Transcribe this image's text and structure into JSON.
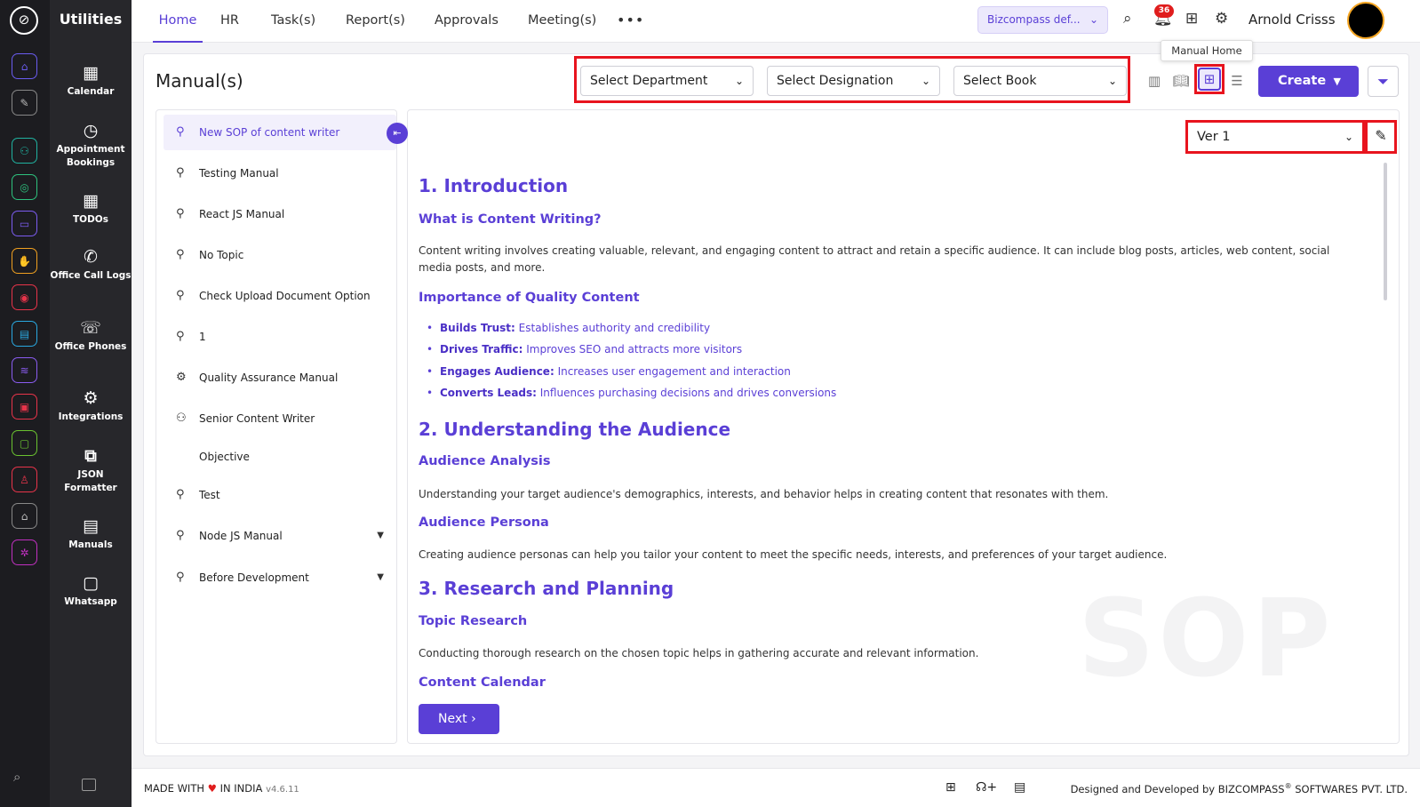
{
  "rail": {
    "logo": "⊘"
  },
  "subnav": {
    "title": "Utilities",
    "items": [
      {
        "label": "Calendar",
        "icon": "calendar-icon"
      },
      {
        "label": "Appointment Bookings",
        "icon": "appointment-icon"
      },
      {
        "label": "TODOs",
        "icon": "todo-icon"
      },
      {
        "label": "Office Call Logs",
        "icon": "phone-call-icon"
      },
      {
        "label": "Office Phones",
        "icon": "office-phone-icon"
      },
      {
        "label": "Integrations",
        "icon": "gear-icon"
      },
      {
        "label": "JSON Formatter",
        "icon": "code-icon"
      },
      {
        "label": "Manuals",
        "icon": "manual-icon"
      },
      {
        "label": "Whatsapp",
        "icon": "chat-icon"
      }
    ]
  },
  "topbar": {
    "tabs": [
      "Home",
      "HR",
      "Task(s)",
      "Report(s)",
      "Approvals",
      "Meeting(s)"
    ],
    "more": "•••",
    "company": "Bizcompass def...",
    "notification_count": "36",
    "user_name": "Arnold Crisss",
    "tooltip": "Manual Home"
  },
  "page": {
    "title": "Manual(s)",
    "filters": {
      "department": "Select Department",
      "designation": "Select Designation",
      "book": "Select Book"
    },
    "create_label": "Create",
    "version": "Ver 1",
    "next_label": "Next"
  },
  "manuals": [
    {
      "label": "New SOP of content writer",
      "icon": "bulb-icon",
      "active": true
    },
    {
      "label": "Testing Manual",
      "icon": "bulb-icon"
    },
    {
      "label": "React JS Manual",
      "icon": "bulb-icon"
    },
    {
      "label": "No Topic",
      "icon": "bulb-icon"
    },
    {
      "label": "Check Upload Document Option",
      "icon": "bulb-icon"
    },
    {
      "label": "1",
      "icon": "bulb-icon"
    },
    {
      "label": "Quality Assurance Manual",
      "icon": "gear-icon"
    },
    {
      "label": "Senior Content Writer",
      "icon": "user-gear-icon"
    },
    {
      "label": "Objective",
      "icon": ""
    },
    {
      "label": "Test",
      "icon": "bulb-icon"
    },
    {
      "label": "Node JS Manual",
      "icon": "bulb-icon",
      "expandable": true
    },
    {
      "label": "Before Development",
      "icon": "bulb-icon",
      "expandable": true
    }
  ],
  "doc": {
    "h1_intro": "1. Introduction",
    "h2_what": "What is Content Writing?",
    "p_what": "Content writing involves creating valuable, relevant, and engaging content to attract and retain a specific audience. It can include blog posts, articles, web content, social media posts, and more.",
    "h2_importance": "Importance of Quality Content",
    "bullets": [
      {
        "bold": "Builds Trust:",
        "text": " Establishes authority and credibility"
      },
      {
        "bold": "Drives Traffic:",
        "text": " Improves SEO and attracts more visitors"
      },
      {
        "bold": "Engages Audience:",
        "text": " Increases user engagement and interaction"
      },
      {
        "bold": "Converts Leads:",
        "text": " Influences purchasing decisions and drives conversions"
      }
    ],
    "h1_audience": "2. Understanding the Audience",
    "h2_analysis": "Audience Analysis",
    "p_analysis": "Understanding your target audience's demographics, interests, and behavior helps in creating content that resonates with them.",
    "h2_persona": "Audience Persona",
    "p_persona": "Creating audience personas can help you tailor your content to meet the specific needs, interests, and preferences of your target audience.",
    "h1_research": "3. Research and Planning",
    "h2_topic": "Topic Research",
    "p_topic": "Conducting thorough research on the chosen topic helps in gathering accurate and relevant information.",
    "h2_calendar": "Content Calendar",
    "watermark": "SOP"
  },
  "footer": {
    "made_with": "MADE WITH",
    "in_india": "IN INDIA",
    "version": "v4.6.11",
    "designed_by": "Designed and Developed by",
    "company": "BIZCOMPASS",
    "reg": "®",
    "company_rest": "SOFTWARES PVT. LTD."
  },
  "colors": {
    "accent": "#5a3fd6",
    "highlight": "#e8141e",
    "sidebar": "#1c1c20"
  }
}
